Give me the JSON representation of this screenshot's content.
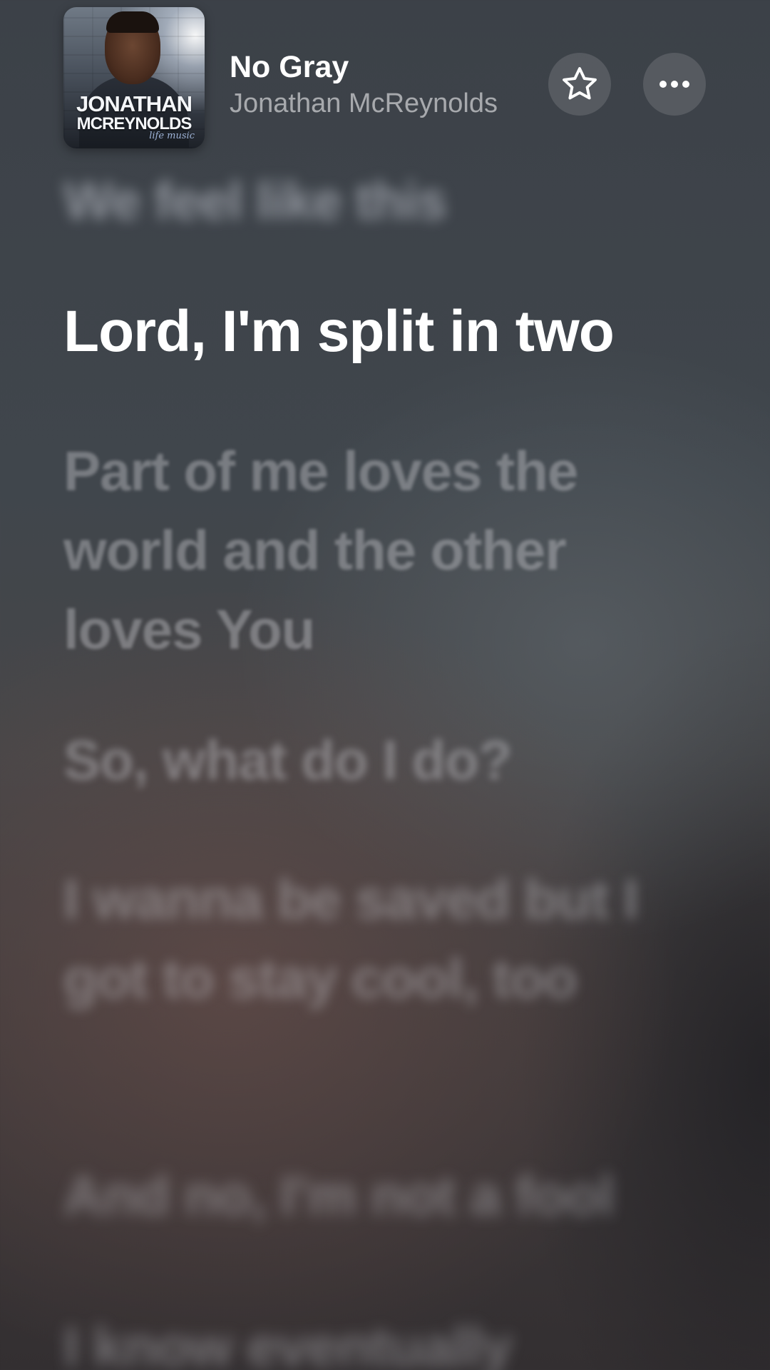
{
  "now_playing": {
    "title": "No Gray",
    "artist": "Jonathan McReynolds",
    "artwork": {
      "line1": "JONATHAN",
      "line2": "MCREYNOLDS",
      "subtitle": "life music"
    }
  },
  "actions": {
    "favorite_icon": "star-outline-icon",
    "more_icon": "ellipsis-icon"
  },
  "lyrics": {
    "previous": "We feel like this",
    "current": "Lord, I'm split in two",
    "upcoming": [
      "Part of me loves the world and the other loves You",
      "So, what do I do?",
      "I wanna be saved but I got to stay cool, too",
      "And no, I'm not a fool",
      "I know eventually"
    ]
  },
  "colors": {
    "background_top": "#3c4148",
    "background_bottom": "#332f31",
    "active_lyric": "#ffffff",
    "inactive_lyric": "#c8c8cd"
  }
}
